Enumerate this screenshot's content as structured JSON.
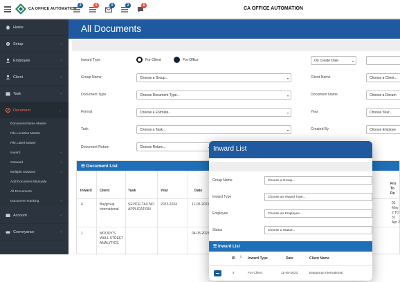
{
  "app": {
    "logo_text": "CA OFFICE AUTOMATION",
    "title": "CA OFFICE AUTOMATION"
  },
  "topbar_icons": [
    {
      "name": "tasks-icon",
      "badge": "2",
      "color": "#1f5aa0"
    },
    {
      "name": "document-icon",
      "badge": "0",
      "color": "#e74c3c"
    },
    {
      "name": "mail-icon",
      "badge": "0",
      "color": "#1f5aa0"
    },
    {
      "name": "list-icon",
      "badge": "2",
      "color": "#1f5aa0"
    },
    {
      "name": "chat-icon",
      "badge": "0",
      "color": "#e74c3c"
    }
  ],
  "sidebar": {
    "items": [
      {
        "label": "Home"
      },
      {
        "label": "Setup"
      },
      {
        "label": "Employee"
      },
      {
        "label": "Client"
      },
      {
        "label": "Task"
      },
      {
        "label": "Document"
      }
    ],
    "subitems": [
      {
        "label": "Document Name Master"
      },
      {
        "label": "File Location Master"
      },
      {
        "label": "File Label Master"
      },
      {
        "label": "Inward"
      },
      {
        "label": "Outward"
      },
      {
        "label": "Multiple Outward"
      },
      {
        "label": "Add Document Manually"
      },
      {
        "label": "All Documents"
      },
      {
        "label": "Document Tracking"
      }
    ],
    "bottom_items": [
      {
        "label": "Account"
      },
      {
        "label": "Conveyance"
      }
    ]
  },
  "page": {
    "title": "All Documents"
  },
  "filters": {
    "inward_type_label": "Inward Type",
    "radio_client": "For Client",
    "radio_office": "For Office",
    "date_select": "On Create Date",
    "group_name_label": "Group Name",
    "group_name_value": "Choose a Group...",
    "client_name_label": "Client Name",
    "client_name_value": "Choose a Client...",
    "document_type_label": "Document Type",
    "document_type_value": "Choose Document Type...",
    "document_name_label": "Document Name",
    "document_name_value": "Choose a Docum",
    "format_label": "Format",
    "format_value": "Choose a Formate...",
    "year_label": "Year",
    "year_value": "Choose Year...",
    "task_label": "Task",
    "task_value": "Choose a Task...",
    "created_by_label": "Created By",
    "created_by_value": "Choose Employe",
    "document_return_label": "Document Return",
    "document_return_value": "Choose Return..."
  },
  "document_list": {
    "title": "Document List",
    "columns": [
      "Inward",
      "Client",
      "Task",
      "Year",
      "Date"
    ],
    "rows": [
      {
        "inward": "4",
        "client": "Baygroup International",
        "task": "SEVICE TAX NO APPLICATION",
        "year": "2023-2024",
        "date": "11-05-2023"
      },
      {
        "inward": "1",
        "client": "MOODY'S WALL STREET ANALYTICS",
        "task": "",
        "year": "",
        "date": "04-05-2023"
      }
    ],
    "right_cut_text": "Fro To De",
    "right_cut_values": "01 May 2 TO 31 Apr 2"
  },
  "inward_popup": {
    "title": "Inward List",
    "group_name_label": "Group Name",
    "group_name_value": "Choose a Group...",
    "inward_type_label": "Inward Type",
    "inward_type_value": "Choose an Inward Type...",
    "employee_label": "Employee",
    "employee_value": "Choose an Employee...",
    "status_label": "Status",
    "status_value": "Choose a Status...",
    "list_title": "Inward List",
    "columns": [
      "ID",
      "Inward Type",
      "Date",
      "Client Name"
    ],
    "rows": [
      {
        "id": "4",
        "inward_type": "For Client",
        "date": "11-05-2023",
        "client_name": "Baygroup International"
      }
    ]
  }
}
